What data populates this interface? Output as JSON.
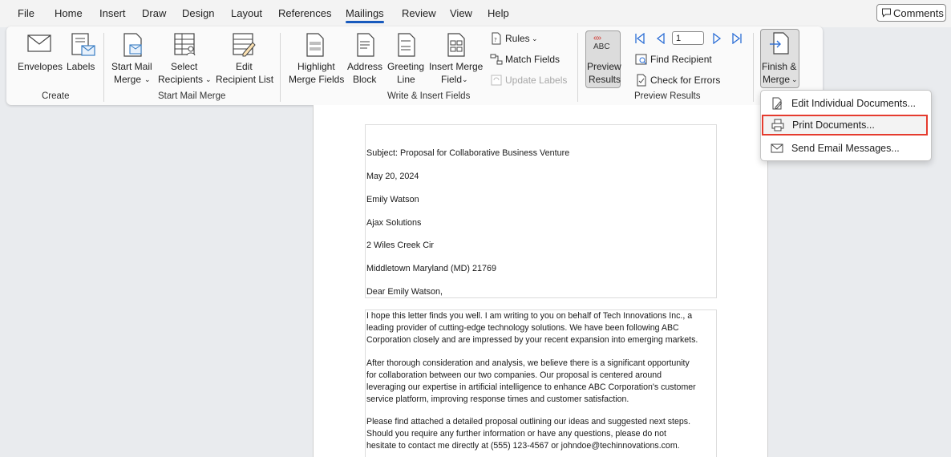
{
  "menubar": {
    "items": [
      "File",
      "Home",
      "Insert",
      "Draw",
      "Design",
      "Layout",
      "References",
      "Mailings",
      "Review",
      "View",
      "Help"
    ],
    "active": "Mailings",
    "comments_label": "Comments"
  },
  "ribbon": {
    "create": {
      "envelopes": "Envelopes",
      "labels": "Labels",
      "group": "Create"
    },
    "start_mail_merge": {
      "start_line1": "Start Mail",
      "start_line2": "Merge",
      "select_line1": "Select",
      "select_line2": "Recipients",
      "edit_line1": "Edit",
      "edit_line2": "Recipient List",
      "group": "Start Mail Merge"
    },
    "write_insert": {
      "highlight_line1": "Highlight",
      "highlight_line2": "Merge Fields",
      "address_line1": "Address",
      "address_line2": "Block",
      "greeting_line1": "Greeting",
      "greeting_line2": "Line",
      "insert_line1": "Insert Merge",
      "insert_line2": "Field",
      "rules": "Rules",
      "match_fields": "Match Fields",
      "update_labels": "Update Labels",
      "group": "Write & Insert Fields"
    },
    "preview": {
      "abc_text": "ABC",
      "preview_line1": "Preview",
      "preview_line2": "Results",
      "record_value": "1",
      "find_recipient": "Find Recipient",
      "check_errors": "Check for Errors",
      "group": "Preview Results"
    },
    "finish": {
      "line1": "Finish &",
      "line2": "Merge"
    }
  },
  "dropdown": {
    "items": [
      "Edit Individual Documents...",
      "Print Documents...",
      "Send Email Messages..."
    ]
  },
  "document": {
    "subject": "Subject: Proposal for Collaborative Business Venture",
    "date": "May 20, 2024",
    "name": "Emily Watson",
    "company": "Ajax Solutions",
    "street": "2 Wiles Creek Cir",
    "city": "Middletown Maryland (MD) 21769",
    "salutation": "Dear Emily Watson,",
    "paragraphs": [
      [
        "I hope this letter finds you well. I am writing to you on behalf of Tech Innovations Inc., a",
        "leading provider of cutting-edge technology solutions. We have been following ABC",
        "Corporation closely and are impressed by your recent expansion into emerging markets."
      ],
      [
        "After thorough consideration and analysis, we believe there is a significant opportunity",
        "for collaboration between our two companies. Our proposal is centered around",
        "leveraging our expertise in artificial intelligence to enhance ABC Corporation's customer",
        "service platform, improving response times and customer satisfaction."
      ],
      [
        "Please find attached a detailed proposal outlining our ideas and suggested next steps.",
        "Should you require any further information or have any questions, please do not",
        "hesitate to contact me directly at (555) 123-4567 or johndoe@techinnovations.com."
      ]
    ]
  }
}
